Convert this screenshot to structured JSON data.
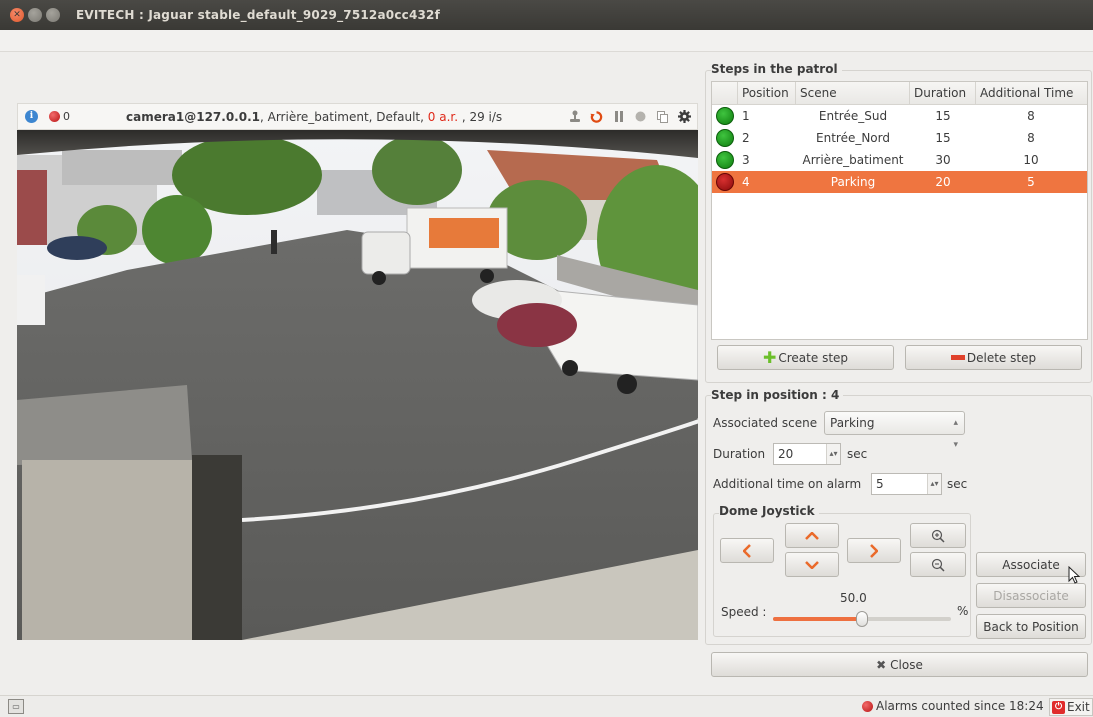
{
  "window": {
    "title": "EVITECH : Jaguar stable_default_9029_7512a0cc432f",
    "controls": [
      "close",
      "minimize",
      "maximize"
    ]
  },
  "camera": {
    "alarm_count": "0",
    "camera_name": "camera1@127.0.0.1",
    "info_rest": ", Arrière_batiment, Default, ",
    "ar_text": "0 a.r.",
    "fps_text": " , 29 i/s",
    "tools": [
      "joystick-icon",
      "refresh-icon",
      "pause-icon",
      "record-icon",
      "copy-icon",
      "settings-icon"
    ]
  },
  "patrol": {
    "title": "Steps in the patrol",
    "columns": [
      "Position",
      "Scene",
      "Duration",
      "Additional Time"
    ],
    "rows": [
      {
        "position": "1",
        "scene": "Entrée_Sud",
        "duration": "15",
        "additional": "8",
        "status": "green"
      },
      {
        "position": "2",
        "scene": "Entrée_Nord",
        "duration": "15",
        "additional": "8",
        "status": "green"
      },
      {
        "position": "3",
        "scene": "Arrière_batiment",
        "duration": "30",
        "additional": "10",
        "status": "green"
      },
      {
        "position": "4",
        "scene": "Parking",
        "duration": "20",
        "additional": "5",
        "status": "red",
        "selected": true
      }
    ],
    "create_label": "Create step",
    "delete_label": "Delete step"
  },
  "step": {
    "title": "Step in position : 4",
    "scene_label": "Associated scene",
    "scene_value": "Parking",
    "duration_label": "Duration",
    "duration_value": "20",
    "duration_unit": "sec",
    "additional_label": "Additional time on alarm",
    "additional_value": "5",
    "additional_unit": "sec"
  },
  "joystick": {
    "title": "Dome Joystick",
    "speed_label": "Speed :",
    "speed_value": "50.0",
    "speed_unit": "%",
    "speed_fraction": 0.5,
    "associate_label": "Associate",
    "disassociate_label": "Disassociate",
    "back_label": "Back to Position"
  },
  "close_label": "Close",
  "status": {
    "alarms_text": "Alarms counted since 18:24",
    "exit_label": "Exit"
  },
  "colors": {
    "accent": "#ef7540",
    "alarm_red": "#e02a1a",
    "ok_green": "#1a9a1a"
  }
}
